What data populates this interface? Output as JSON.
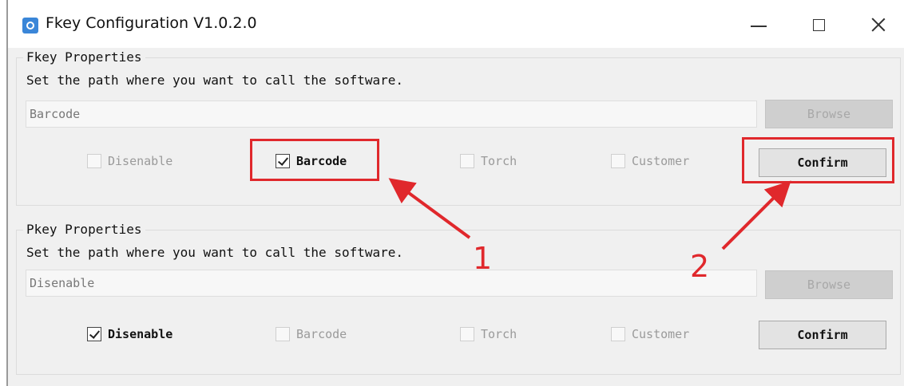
{
  "window": {
    "title": "Fkey Configuration V1.0.2.0",
    "icon": "settings-gear-icon",
    "controls": {
      "minimize": "minimize-icon",
      "maximize": "maximize-icon",
      "close": "close-icon"
    }
  },
  "groups": [
    {
      "legend": "Fkey Properties",
      "description": "Set the path where you want to call the software.",
      "path_value": "Barcode",
      "browse_label": "Browse",
      "confirm_label": "Confirm",
      "options": [
        {
          "label": "Disenable",
          "checked": false
        },
        {
          "label": "Barcode",
          "checked": true
        },
        {
          "label": "Torch",
          "checked": false
        },
        {
          "label": "Customer",
          "checked": false
        }
      ]
    },
    {
      "legend": "Pkey Properties",
      "description": "Set the path where you want to call the software.",
      "path_value": "Disenable",
      "browse_label": "Browse",
      "confirm_label": "Confirm",
      "options": [
        {
          "label": "Disenable",
          "checked": true
        },
        {
          "label": "Barcode",
          "checked": false
        },
        {
          "label": "Torch",
          "checked": false
        },
        {
          "label": "Customer",
          "checked": false
        }
      ]
    }
  ],
  "annotations": {
    "color": "#e0282c",
    "step1": "1",
    "step2": "2"
  }
}
